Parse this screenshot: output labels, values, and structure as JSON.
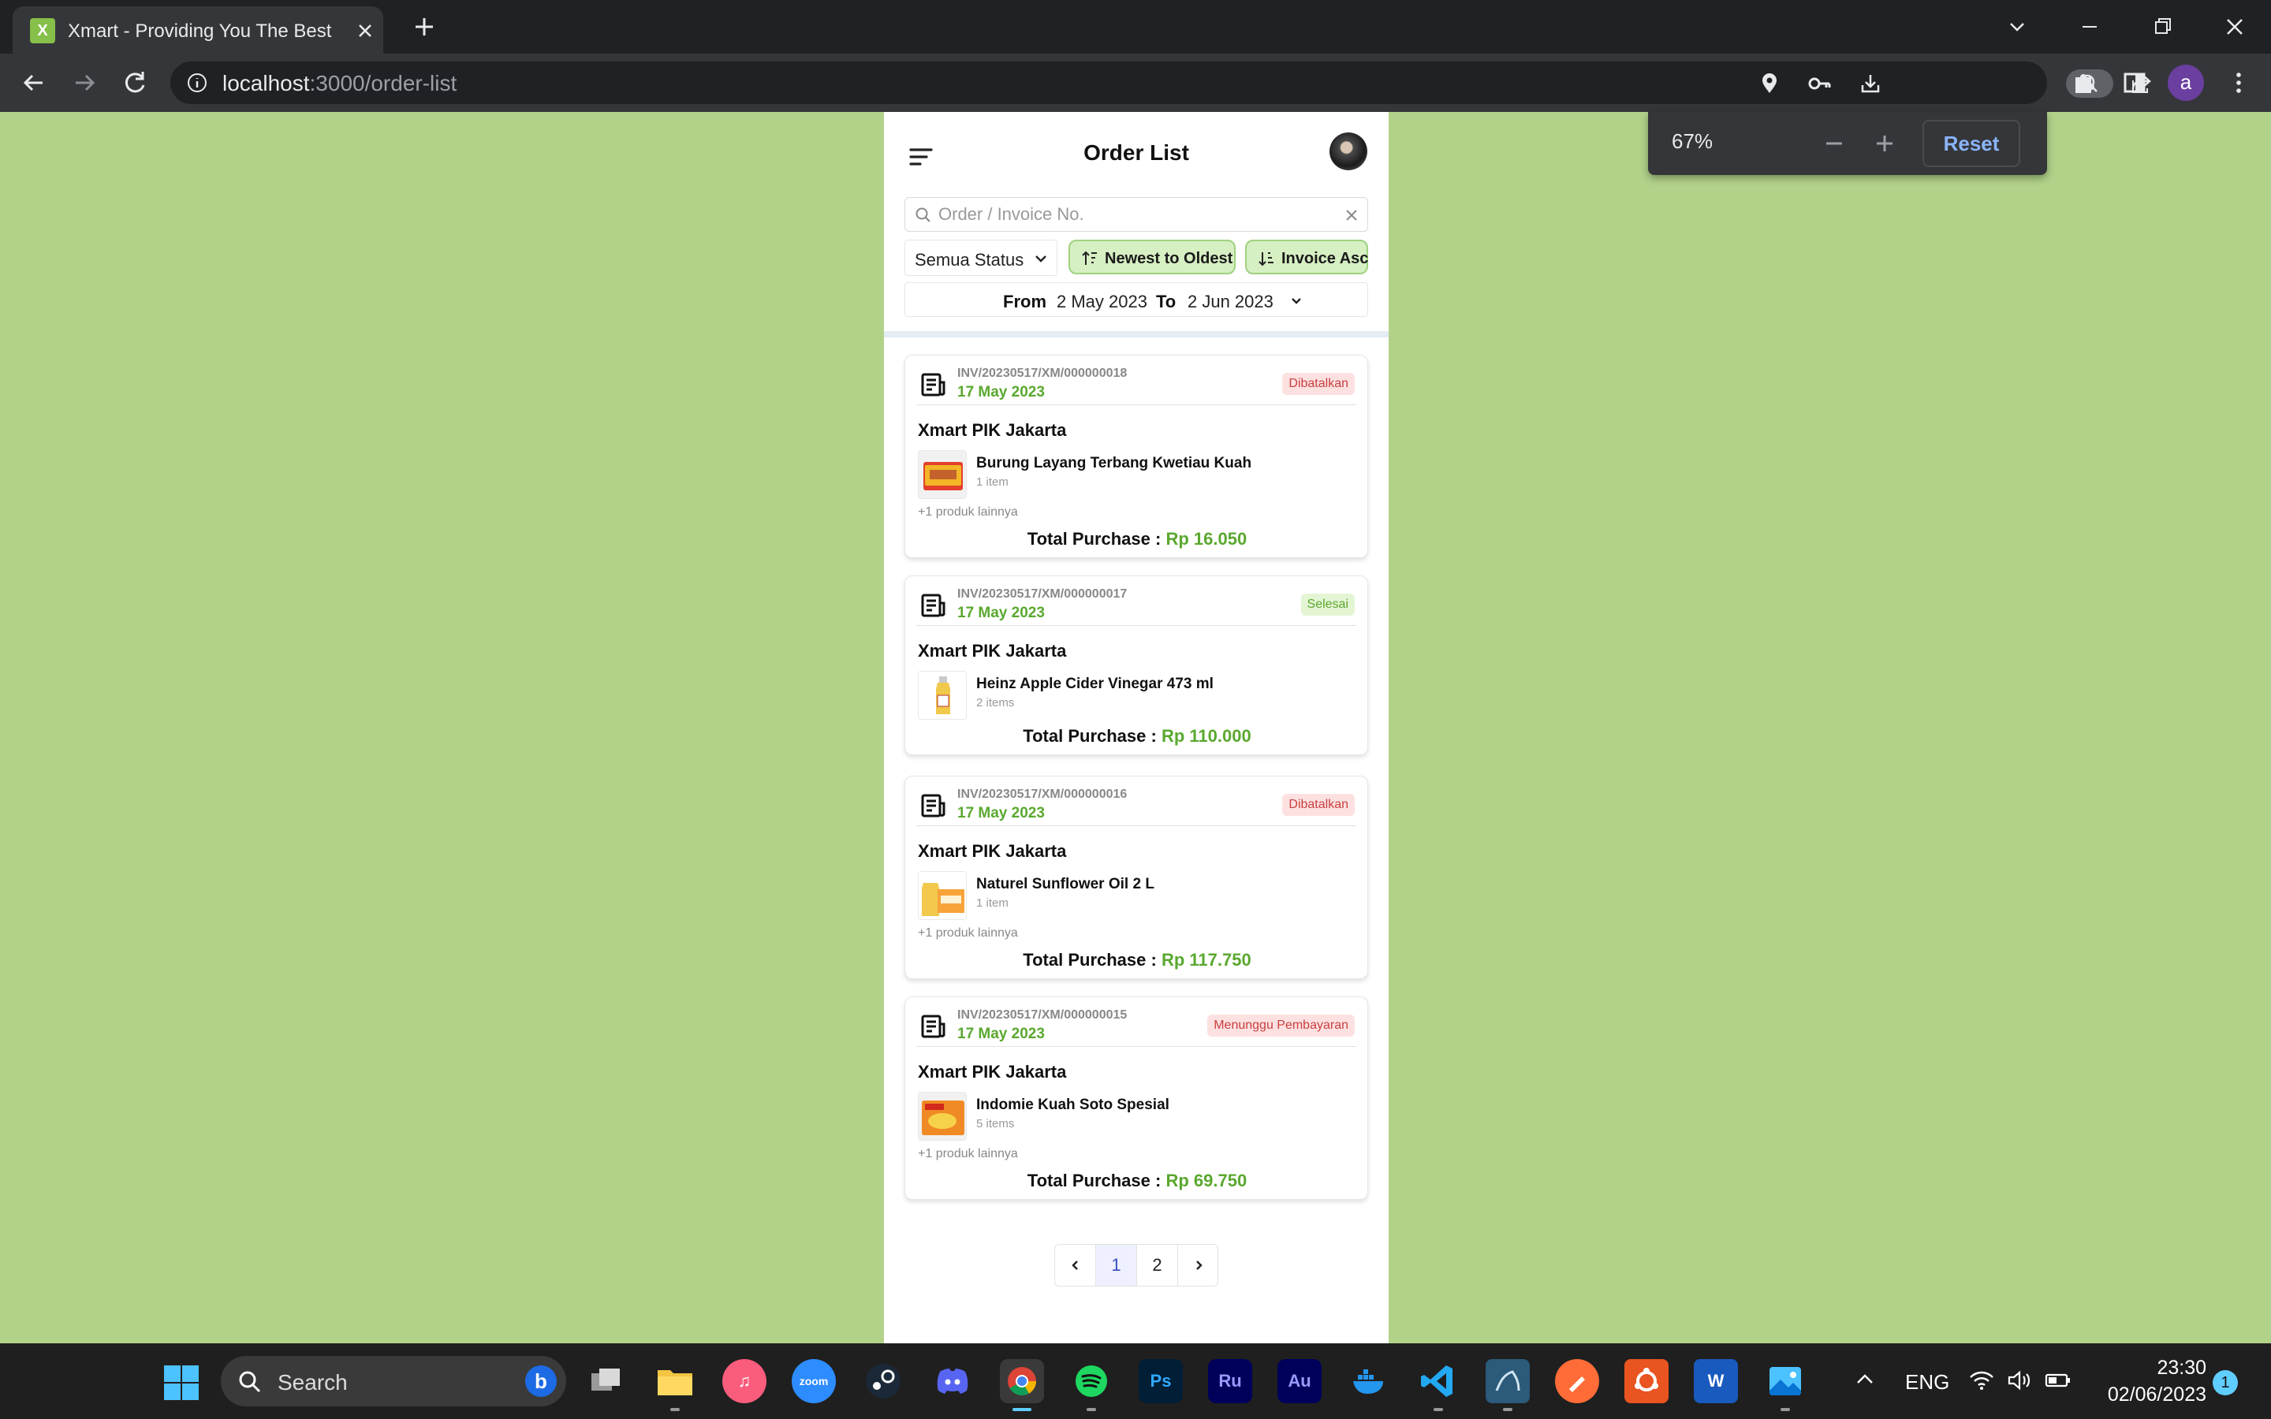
{
  "browser": {
    "tab_title": "Xmart - Providing You The Best Grocery",
    "url_host": "localhost",
    "url_path": ":3000/order-list",
    "profile_letter": "a",
    "zoom": {
      "level": "67%",
      "reset_label": "Reset"
    }
  },
  "app": {
    "title": "Order List",
    "search_placeholder": "Order / Invoice No.",
    "status_filter": "Semua Status",
    "sort_date_label": "Newest to Oldest",
    "sort_invoice_label": "Invoice Asc",
    "date_range": {
      "from_label": "From",
      "from": "2 May 2023",
      "to_label": "To",
      "to": "2 Jun 2023"
    },
    "total_label": "Total Purchase :",
    "orders": [
      {
        "invoice": "INV/20230517/XM/000000018",
        "date": "17 May 2023",
        "status": "Dibatalkan",
        "store": "Xmart PIK Jakarta",
        "product": "Burung Layang Terbang Kwetiau Kuah",
        "qty": "1 item",
        "more": "+1 produk lainnya",
        "total": "Rp 16.050"
      },
      {
        "invoice": "INV/20230517/XM/000000017",
        "date": "17 May 2023",
        "status": "Selesai",
        "store": "Xmart PIK Jakarta",
        "product": "Heinz Apple Cider Vinegar 473 ml",
        "qty": "2 items",
        "more": "",
        "total": "Rp 110.000"
      },
      {
        "invoice": "INV/20230517/XM/000000016",
        "date": "17 May 2023",
        "status": "Dibatalkan",
        "store": "Xmart PIK Jakarta",
        "product": "Naturel Sunflower Oil 2 L",
        "qty": "1 item",
        "more": "+1 produk lainnya",
        "total": "Rp 117.750"
      },
      {
        "invoice": "INV/20230517/XM/000000015",
        "date": "17 May 2023",
        "status": "Menunggu Pembayaran",
        "store": "Xmart PIK Jakarta",
        "product": "Indomie Kuah Soto Spesial",
        "qty": "5 items",
        "more": "+1 produk lainnya",
        "total": "Rp 69.750"
      }
    ],
    "pagination": {
      "pages": [
        "1",
        "2"
      ],
      "current": "1"
    }
  },
  "taskbar": {
    "search_label": "Search",
    "apps": [
      "files-icon",
      "explorer",
      "itunes",
      "zoom",
      "steam",
      "discord",
      "chrome",
      "spotify",
      "photoshop",
      "premiere-rush",
      "audition",
      "docker",
      "vscode",
      "mysql-workbench",
      "postman",
      "ubuntu",
      "word",
      "photos"
    ],
    "zoom_label": "zoom",
    "ps_label": "Ps",
    "ru_label": "Ru",
    "au_label": "Au",
    "w_label": "W",
    "lang": "ENG",
    "time": "23:30",
    "date": "02/06/2023",
    "notifications": "1"
  }
}
